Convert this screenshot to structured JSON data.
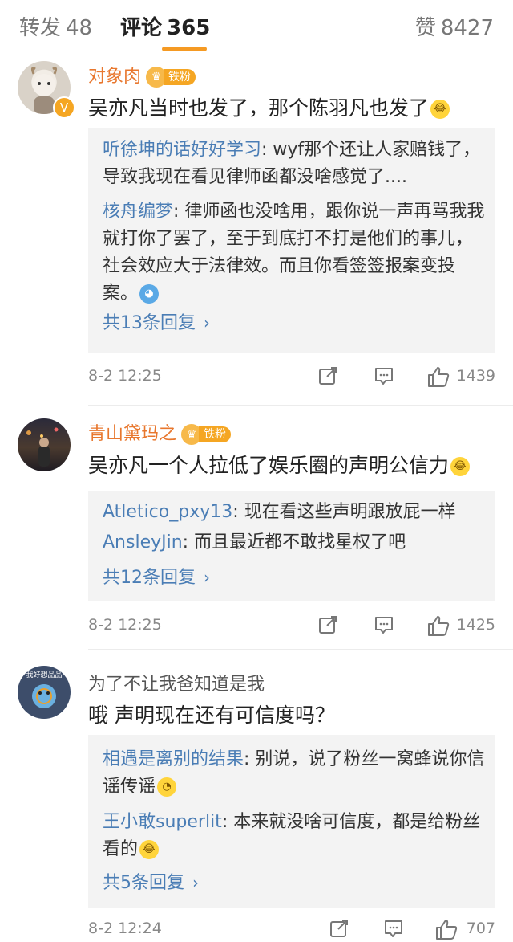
{
  "tabs": {
    "repost": {
      "label": "转发",
      "count": "48"
    },
    "comment": {
      "label": "评论",
      "count": "365"
    },
    "like": {
      "label": "赞",
      "count": "8427"
    }
  },
  "comments": [
    {
      "user": "对象肉",
      "badge": "铁粉",
      "text": "吴亦凡当时也发了，那个陈羽凡也发了",
      "replies": [
        {
          "name": "听徐坤的话好好学习",
          "text": ": wyf那个还让人家赔钱了，导致我现在看见律师函都没啥感觉了...."
        },
        {
          "name": "核舟编梦",
          "text": ": 律师函也没啥用，跟你说一声再骂我我就打你了罢了，至于到底打不打是他们的事儿，社会效应大于法律效。而且你看签签报案变投案。"
        }
      ],
      "more": "共13条回复",
      "time": "8-2 12:25",
      "likes": "1439"
    },
    {
      "user": "青山黛玛之",
      "badge": "铁粉",
      "text": "吴亦凡一个人拉低了娱乐圈的声明公信力",
      "replies": [
        {
          "name": "Atletico_pxy13",
          "text": ": 现在看这些声明跟放屁一样"
        },
        {
          "name": "AnsleyJin",
          "text": ": 而且最近都不敢找星权了吧"
        }
      ],
      "more": "共12条回复",
      "time": "8-2 12:25",
      "likes": "1425"
    },
    {
      "user": "为了不让我爸知道是我",
      "avatar_text": "我好想品品",
      "text": "哦 声明现在还有可信度吗？",
      "replies": [
        {
          "name": "相遇是离别的结果",
          "text": ": 别说，说了粉丝一窝蜂说你信谣传谣"
        },
        {
          "name": "王小敢superlit",
          "text": ": 本来就没啥可信度，都是给粉丝看的"
        }
      ],
      "more": "共5条回复",
      "time": "8-2 12:24",
      "likes": "707"
    }
  ],
  "icons": [
    "crown-icon",
    "laugh-cry-emoji",
    "doraemon-emoji",
    "doge-emoji",
    "repost-icon",
    "comment-icon",
    "thumbs-up-icon",
    "chevron-right-icon"
  ],
  "colors": {
    "accent": "#f59a23",
    "username": "#e8772e",
    "link": "#4a7db5",
    "reply_bg": "#f3f3f3"
  }
}
